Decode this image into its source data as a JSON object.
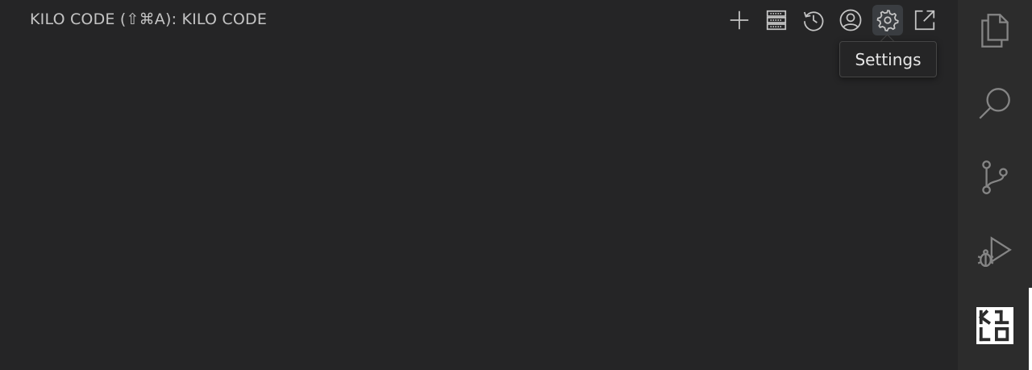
{
  "panel": {
    "title": "KILO CODE (⇧⌘A): KILO CODE"
  },
  "toolbar": {
    "buttons": [
      {
        "name": "new-task-button",
        "icon": "plus-icon"
      },
      {
        "name": "mcp-servers-button",
        "icon": "server-icon"
      },
      {
        "name": "history-button",
        "icon": "history-icon"
      },
      {
        "name": "account-button",
        "icon": "account-icon"
      },
      {
        "name": "settings-button",
        "icon": "gear-icon",
        "active": true
      },
      {
        "name": "open-in-editor-button",
        "icon": "link-external-icon"
      }
    ],
    "tooltip": "Settings"
  },
  "activity_bar": {
    "items": [
      {
        "name": "explorer",
        "icon": "files-icon"
      },
      {
        "name": "search",
        "icon": "search-icon"
      },
      {
        "name": "source-control",
        "icon": "source-control-icon"
      },
      {
        "name": "run-and-debug",
        "icon": "debug-alt-icon"
      },
      {
        "name": "kilo-code",
        "icon": "kilo-code-logo-icon",
        "active": true
      }
    ]
  },
  "colors": {
    "background": "#252526",
    "activity_bar": "#2c2c2c",
    "icon": "#c5c5c5",
    "text": "#c4c4c4",
    "active_indicator": "#ffffff"
  }
}
